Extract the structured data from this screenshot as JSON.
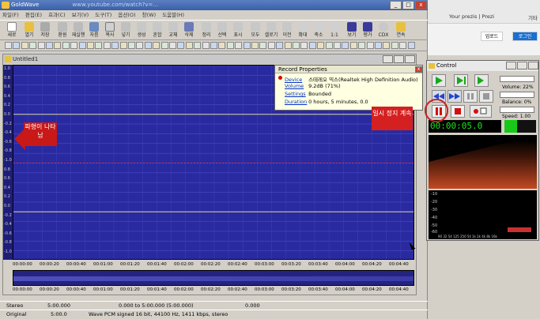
{
  "browser": {
    "bookmark_prezi": "Your prezis | Prezi",
    "bookmark_other": "기타",
    "btn_upload": "업로드",
    "btn_login": "로그인"
  },
  "app": {
    "title": "GoldWave",
    "url_fragment": "www.youtube.com/watch?v=...",
    "minimize": "_",
    "maximize": "□",
    "close": "x"
  },
  "menu": [
    "파일(F)",
    "편집(E)",
    "효과(C)",
    "보기(V)",
    "도구(T)",
    "옵션(O)",
    "창(W)",
    "도움말(H)"
  ],
  "toolbar": [
    "새로",
    "열기",
    "저장",
    "환원",
    "재실행",
    "자름",
    "복사",
    "넣기",
    "생성",
    "혼합",
    "교체",
    "삭제",
    "정리",
    "선택",
    "표시",
    "모두",
    "셀로기",
    "이전",
    "확대",
    "축소",
    "1:1",
    "보기",
    "평가",
    "CDX",
    "연속"
  ],
  "document": {
    "title": "Untitled1"
  },
  "y_axis": [
    "1.0",
    "0.8",
    "0.6",
    "0.4",
    "0.2",
    "0.0",
    "-0.2",
    "-0.4",
    "-0.6",
    "-0.8",
    "-1.0",
    "0.8",
    "0.6",
    "0.4",
    "0.2",
    "0.0",
    "-0.2",
    "-0.4",
    "-0.6",
    "-0.8",
    "-1.0"
  ],
  "timeline": [
    "00:00:00",
    "00:00:20",
    "00:00:40",
    "00:01:00",
    "00:01:20",
    "00:01:40",
    "00:02:00",
    "00:02:20",
    "00:02:40",
    "00:03:00",
    "00:03:20",
    "00:03:40",
    "00:04:00",
    "00:04:20",
    "00:04:40"
  ],
  "status": {
    "row1": {
      "c1": "Stereo",
      "c2": "5:00.000",
      "c3": "0.000 to 5:00.000 (5:00.000)",
      "c4": "0.000"
    },
    "row2": {
      "c1": "Original",
      "c2": "5:00.0",
      "c3": "Wave PCM signed 16 bit, 44100 Hz, 1411 kbps, stereo"
    }
  },
  "record": {
    "title": "Record Properties",
    "device_label": "Device",
    "device_value": "스테레오 믹스(Realtek High Definition Audio)",
    "volume_label": "Volume",
    "volume_value": "9.2dB (71%)",
    "settings_label": "Settings",
    "settings_value": "Bounded",
    "duration_label": "Duration",
    "duration_value": "0 hours, 5 minutes, 0.0"
  },
  "callouts": {
    "left": "파형이 나타남",
    "right": "일시 정지 계속"
  },
  "control": {
    "title": "Control",
    "timer": "00:00:05.0",
    "volume": "Volume: 22%",
    "balance": "Balance: 0%",
    "speed": "Speed: 1.00",
    "meter": [
      "-10",
      "-20",
      "-30",
      "-40",
      "-50",
      "-60"
    ],
    "freq": "90 32 54 125 250 5ll 1k 2k 4k 8k 16k"
  },
  "colors": {
    "wave_bg": "#2a2aa0",
    "accent_red": "#c81818",
    "timer_green": "#18e818"
  }
}
